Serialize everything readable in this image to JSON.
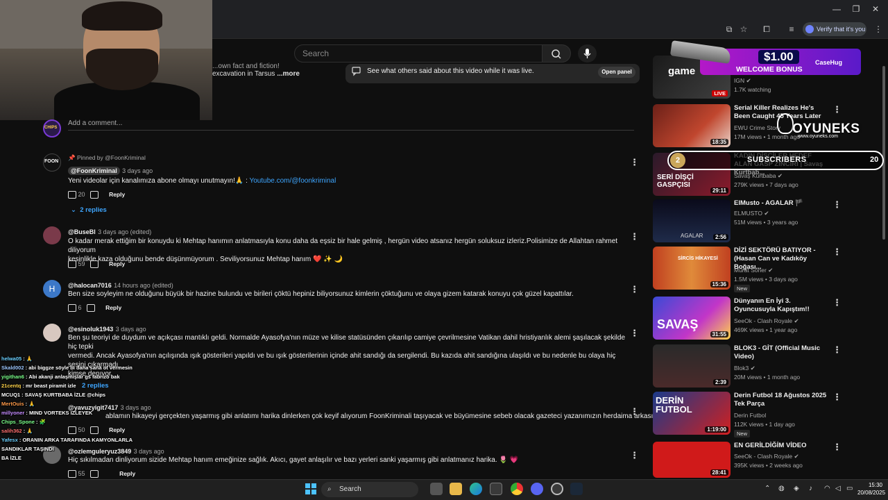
{
  "browser": {
    "verify_label": "Verify that it's you",
    "window_controls": [
      "minimize-icon",
      "restore-icon",
      "close-icon"
    ]
  },
  "youtube": {
    "search_placeholder": "Search",
    "description_line1": "...own fact and fiction!",
    "description_line2": "excavation in Tarsus",
    "description_more": "...more",
    "live_chat_text": "See what others said about this video while it was live.",
    "open_panel_label": "Open panel",
    "add_comment_placeholder": "Add a comment...",
    "comments": [
      {
        "pinned_label": "Pinned by @FoonKriminal",
        "author": "@FoonKriminal",
        "time": "3 days ago",
        "text": "Yeni videolar için kanalımıza abone olmayı unutmayın!🙏 : ",
        "link": "Youtube.com/@foonkriminal",
        "likes": "20",
        "reply_label": "Reply",
        "replies_label": "2 replies"
      },
      {
        "author": "@BuseBl",
        "time": "3 days ago (edited)",
        "text_line1": "O kadar merak ettiğim bir konuydu ki Mehtap hanımın anlatmasıyla konu daha da eşsiz bir hale gelmiş , hergün video atsanız hergün soluksuz izleriz.Polisimize de Allahtan rahmet diliyorum",
        "text_line2": "kesinlikle kaza olduğunu bende düşünmüyorum  . Seviliyorsunuz Mehtap hanım ❤️ ✨ 🌙",
        "likes": "59",
        "reply_label": "Reply"
      },
      {
        "author": "@halocan7016",
        "time": "14 hours ago (edited)",
        "avatar_letter": "H",
        "text": "Ben size soyleyim ne olduğunu büyük bir hazine bulundu ve birileri çöktü hepiniz biliyorsunuz kimlerin çöktuğunu ve olaya gizem katarak konuyu çok güzel kapattılar.",
        "likes": "6",
        "reply_label": "Reply"
      },
      {
        "author": "@esinoluk1943",
        "time": "3 days ago",
        "text_line1": "Ben şu teoriyi de duydum ve açıkçası mantıklı geldi. Normalde Ayasofya'nın müze ve kilise statüsünden çıkarılıp camiye çevrilmesine Vatikan dahil hristiyanlık alemi  şaşılacak şekilde hiç tepki",
        "text_line2": "vermedi. Ancak Ayasofya'nın açılışında ışık gösterileri yapıldı ve bu ışık gösterilerinin içinde ahit sandığı da sergilendi. Bu kazıda ahit sandığına ulaşıldı ve bu nedenle bu olaya hiç sesini çıkarmadı",
        "text_line3": "kimse denıyor.",
        "replies_label": "2 replies"
      },
      {
        "author": "@yavuzyigit7417",
        "time": "3 days ago",
        "text": "ablamın  hikayeyi gerçekten yaşarmış gibi anlatımı harika dinlerken çok keyif alıyorum FoonKriminali taşıyacak ve büyümesine sebeb olacak gazeteci yazanımızın herdaima arkasındayız",
        "likes": "50",
        "reply_label": "Reply"
      },
      {
        "author": "@ozlemguleryuz3849",
        "time": "3 days ago",
        "text": "Hiç sıkılmadan dinliyorum sizide Mehtap hanım emeğinize sağlık. Akıcı, gayet anlaşılır ve bazı yerleri sanki yaşarmış gibi anlatmanız harika. 🌷 💗",
        "likes": "55",
        "reply_label": "Reply"
      }
    ],
    "sidebar": [
      {
        "channel": "IGN",
        "views": "1.7K watching",
        "live": "LIVE",
        "thumb_text": "game"
      },
      {
        "title": "Serial Killer Realizes He's Been Caught 45 Years Later",
        "channel": "EWU Crime Story",
        "views": "17M views • 1 month ago",
        "duration": "18:35"
      },
      {
        "title": "KADIN DİSÇİLER HEDEF ALAN GASP ZİNCİRİ | Savaş Kurtbab...",
        "channel": "Savaş Kurtbaba",
        "views": "279K views • 7 days ago",
        "duration": "29:11",
        "thumb_text": "SERİ DİŞÇİ GASPÇISI"
      },
      {
        "title": "ElMusto - AGALAR 🏴",
        "channel": "ELMUSTO",
        "views": "51M views • 3 years ago",
        "duration": "2:56",
        "thumb_text": "AGALAR"
      },
      {
        "title": "DİZİ SEKTÖRÜ BATIYOR - (Hasan Can ve Kadıköy Boğası...",
        "channel": "Murat Soner",
        "views": "1.5M views • 3 days ago",
        "duration": "15:36",
        "badge": "New",
        "thumb_text": "SİRCİS HİKAYESİ"
      },
      {
        "title": "Dünyanın En İyi 3. Oyuncusuyla Kapıştım!!",
        "channel": "SeeOk - Clash Royale",
        "views": "469K views • 1 year ago",
        "duration": "31:55",
        "thumb_text": "SAVAŞ"
      },
      {
        "title": "BLOK3 - GİT (Official Music Video)",
        "channel": "Blok3",
        "views": "20M views • 1 month ago",
        "duration": "2:39"
      },
      {
        "title": "Derin Futbol 18 Ağustos 2025 Tek Parça",
        "channel": "Derin Futbol",
        "views": "112K views • 1 day ago",
        "duration": "1:19:00",
        "badge": "New",
        "thumb_text": "DERİN FUTBOL"
      },
      {
        "title": "EN GERİLDİĞİM VİDEO",
        "channel": "SeeOk - Clash Royale",
        "views": "395K views • 2 weeks ago",
        "duration": "28:41"
      }
    ]
  },
  "overlays": {
    "promo_amount": "$1.00",
    "promo_welcome": "WELCOME BONUS",
    "promo_brand": "CaseHug",
    "oyuneks": "OYUNEKS",
    "oyuneks_url": "www.oyuneks.com",
    "subs_current": "2",
    "subs_label": "SUBSCRIBERS",
    "subs_goal": "20",
    "chat": [
      {
        "user": "helwa05",
        "msg": ": 🙏",
        "color": "#6bd0ff"
      },
      {
        "user": "Skald002",
        "msg": ": abi biggze söyle bi daha sana ot vermesin",
        "color": "#9ec8ff"
      },
      {
        "user": "yigithan6",
        "msg": ": Abi akanji anlaşmışlar gs fabrizo bak",
        "color": "#7bff8a"
      },
      {
        "user": "21centq",
        "msg": ": mr beast piramit izle",
        "color": "#ffd34a"
      },
      {
        "user": "MCUQ1",
        "msg": ": SAVAŞ KURTBABA İZLE @chips",
        "color": "#ffffff"
      },
      {
        "user": "MertOuis",
        "msg": ": 🙏",
        "color": "#ff9b4a"
      },
      {
        "user": "millyoner",
        "msg": ": MIND VORTEKS IZLEYEK",
        "color": "#c58cff"
      },
      {
        "user": "Chips_Spone",
        "msg": ": 🧩",
        "color": "#7bff8a"
      },
      {
        "user": "salih362",
        "msg": ": 🙏",
        "color": "#ff7070"
      },
      {
        "user": "Yafesx",
        "msg": ": ORANIN ARKA TARAFINDA KAMYONLARLA",
        "color": "#6bd0ff"
      },
      {
        "user": "",
        "msg": "SANDIKLAR TAŞINDI",
        "color": "#ffffff"
      },
      {
        "user": "",
        "msg": "BA İZLE",
        "color": "#ffffff"
      }
    ]
  },
  "taskbar": {
    "search_label": "Search",
    "time": "15:30",
    "date": "20/08/2025"
  }
}
